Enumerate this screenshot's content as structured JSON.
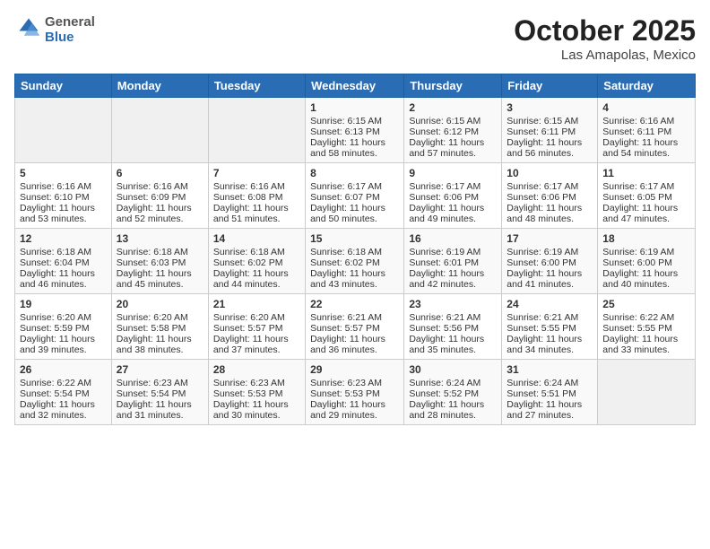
{
  "header": {
    "logo_line1": "General",
    "logo_line2": "Blue",
    "month": "October 2025",
    "location": "Las Amapolas, Mexico"
  },
  "days_of_week": [
    "Sunday",
    "Monday",
    "Tuesday",
    "Wednesday",
    "Thursday",
    "Friday",
    "Saturday"
  ],
  "weeks": [
    [
      {
        "day": "",
        "info": ""
      },
      {
        "day": "",
        "info": ""
      },
      {
        "day": "",
        "info": ""
      },
      {
        "day": "1",
        "info": "Sunrise: 6:15 AM\nSunset: 6:13 PM\nDaylight: 11 hours\nand 58 minutes."
      },
      {
        "day": "2",
        "info": "Sunrise: 6:15 AM\nSunset: 6:12 PM\nDaylight: 11 hours\nand 57 minutes."
      },
      {
        "day": "3",
        "info": "Sunrise: 6:15 AM\nSunset: 6:11 PM\nDaylight: 11 hours\nand 56 minutes."
      },
      {
        "day": "4",
        "info": "Sunrise: 6:16 AM\nSunset: 6:11 PM\nDaylight: 11 hours\nand 54 minutes."
      }
    ],
    [
      {
        "day": "5",
        "info": "Sunrise: 6:16 AM\nSunset: 6:10 PM\nDaylight: 11 hours\nand 53 minutes."
      },
      {
        "day": "6",
        "info": "Sunrise: 6:16 AM\nSunset: 6:09 PM\nDaylight: 11 hours\nand 52 minutes."
      },
      {
        "day": "7",
        "info": "Sunrise: 6:16 AM\nSunset: 6:08 PM\nDaylight: 11 hours\nand 51 minutes."
      },
      {
        "day": "8",
        "info": "Sunrise: 6:17 AM\nSunset: 6:07 PM\nDaylight: 11 hours\nand 50 minutes."
      },
      {
        "day": "9",
        "info": "Sunrise: 6:17 AM\nSunset: 6:06 PM\nDaylight: 11 hours\nand 49 minutes."
      },
      {
        "day": "10",
        "info": "Sunrise: 6:17 AM\nSunset: 6:06 PM\nDaylight: 11 hours\nand 48 minutes."
      },
      {
        "day": "11",
        "info": "Sunrise: 6:17 AM\nSunset: 6:05 PM\nDaylight: 11 hours\nand 47 minutes."
      }
    ],
    [
      {
        "day": "12",
        "info": "Sunrise: 6:18 AM\nSunset: 6:04 PM\nDaylight: 11 hours\nand 46 minutes."
      },
      {
        "day": "13",
        "info": "Sunrise: 6:18 AM\nSunset: 6:03 PM\nDaylight: 11 hours\nand 45 minutes."
      },
      {
        "day": "14",
        "info": "Sunrise: 6:18 AM\nSunset: 6:02 PM\nDaylight: 11 hours\nand 44 minutes."
      },
      {
        "day": "15",
        "info": "Sunrise: 6:18 AM\nSunset: 6:02 PM\nDaylight: 11 hours\nand 43 minutes."
      },
      {
        "day": "16",
        "info": "Sunrise: 6:19 AM\nSunset: 6:01 PM\nDaylight: 11 hours\nand 42 minutes."
      },
      {
        "day": "17",
        "info": "Sunrise: 6:19 AM\nSunset: 6:00 PM\nDaylight: 11 hours\nand 41 minutes."
      },
      {
        "day": "18",
        "info": "Sunrise: 6:19 AM\nSunset: 6:00 PM\nDaylight: 11 hours\nand 40 minutes."
      }
    ],
    [
      {
        "day": "19",
        "info": "Sunrise: 6:20 AM\nSunset: 5:59 PM\nDaylight: 11 hours\nand 39 minutes."
      },
      {
        "day": "20",
        "info": "Sunrise: 6:20 AM\nSunset: 5:58 PM\nDaylight: 11 hours\nand 38 minutes."
      },
      {
        "day": "21",
        "info": "Sunrise: 6:20 AM\nSunset: 5:57 PM\nDaylight: 11 hours\nand 37 minutes."
      },
      {
        "day": "22",
        "info": "Sunrise: 6:21 AM\nSunset: 5:57 PM\nDaylight: 11 hours\nand 36 minutes."
      },
      {
        "day": "23",
        "info": "Sunrise: 6:21 AM\nSunset: 5:56 PM\nDaylight: 11 hours\nand 35 minutes."
      },
      {
        "day": "24",
        "info": "Sunrise: 6:21 AM\nSunset: 5:55 PM\nDaylight: 11 hours\nand 34 minutes."
      },
      {
        "day": "25",
        "info": "Sunrise: 6:22 AM\nSunset: 5:55 PM\nDaylight: 11 hours\nand 33 minutes."
      }
    ],
    [
      {
        "day": "26",
        "info": "Sunrise: 6:22 AM\nSunset: 5:54 PM\nDaylight: 11 hours\nand 32 minutes."
      },
      {
        "day": "27",
        "info": "Sunrise: 6:23 AM\nSunset: 5:54 PM\nDaylight: 11 hours\nand 31 minutes."
      },
      {
        "day": "28",
        "info": "Sunrise: 6:23 AM\nSunset: 5:53 PM\nDaylight: 11 hours\nand 30 minutes."
      },
      {
        "day": "29",
        "info": "Sunrise: 6:23 AM\nSunset: 5:53 PM\nDaylight: 11 hours\nand 29 minutes."
      },
      {
        "day": "30",
        "info": "Sunrise: 6:24 AM\nSunset: 5:52 PM\nDaylight: 11 hours\nand 28 minutes."
      },
      {
        "day": "31",
        "info": "Sunrise: 6:24 AM\nSunset: 5:51 PM\nDaylight: 11 hours\nand 27 minutes."
      },
      {
        "day": "",
        "info": ""
      }
    ]
  ]
}
